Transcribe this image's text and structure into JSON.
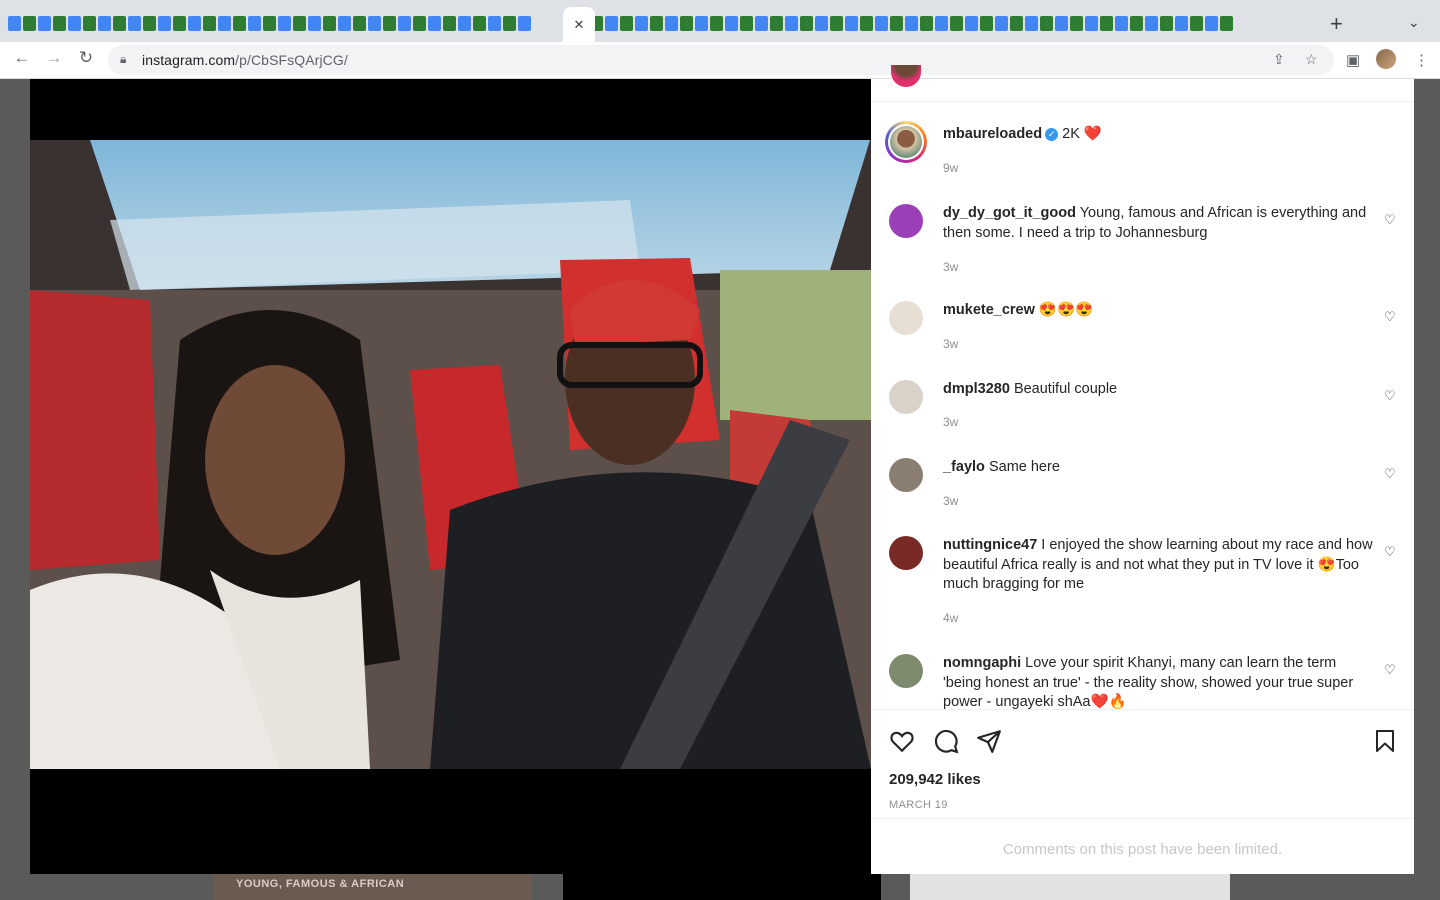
{
  "browser": {
    "active_tab_close": "✕",
    "new_tab": "+",
    "tab_search": "⌄",
    "url_host": "instagram.com",
    "url_path": "/p/CbSFsQArjCG/"
  },
  "background": {
    "thumb_caption": "YOUNG, FAMOUS & AFRICAN"
  },
  "post": {
    "owner": {
      "username": "mbaureloaded",
      "likes_text": "2K",
      "emoji": "❤️",
      "time": "9w"
    },
    "comments": [
      {
        "user": "dy_dy_got_it_good",
        "text": "Young, famous and African is everything and then some. I need a trip to Johannesburg",
        "time": "3w",
        "avatar_color": "#9a3fb5"
      },
      {
        "user": "mukete_crew",
        "text": "😍😍😍",
        "time": "3w",
        "avatar_color": "#e8dfd4"
      },
      {
        "user": "dmpl3280",
        "text": "Beautiful couple",
        "time": "3w",
        "avatar_color": "#d9d2c8"
      },
      {
        "user": "_faylo",
        "text": "Same here",
        "time": "3w",
        "avatar_color": "#8a7d72"
      },
      {
        "user": "nuttingnice47",
        "text": "I enjoyed the show learning about my race and how beautiful Africa really is and not what they put in TV love it 😍Too much bragging for me",
        "time": "4w",
        "avatar_color": "#7a2a26"
      },
      {
        "user": "nomngaphi",
        "text": "Love your spirit Khanyi, many can learn the term 'being honest an true' - the reality show, showed your true super power - ungayeki shAa❤️🔥",
        "time": "",
        "avatar_color": "#7d8a6e"
      }
    ],
    "likes": "209,942 likes",
    "date": "MARCH 19",
    "comments_limited": "Comments on this post have been limited."
  }
}
